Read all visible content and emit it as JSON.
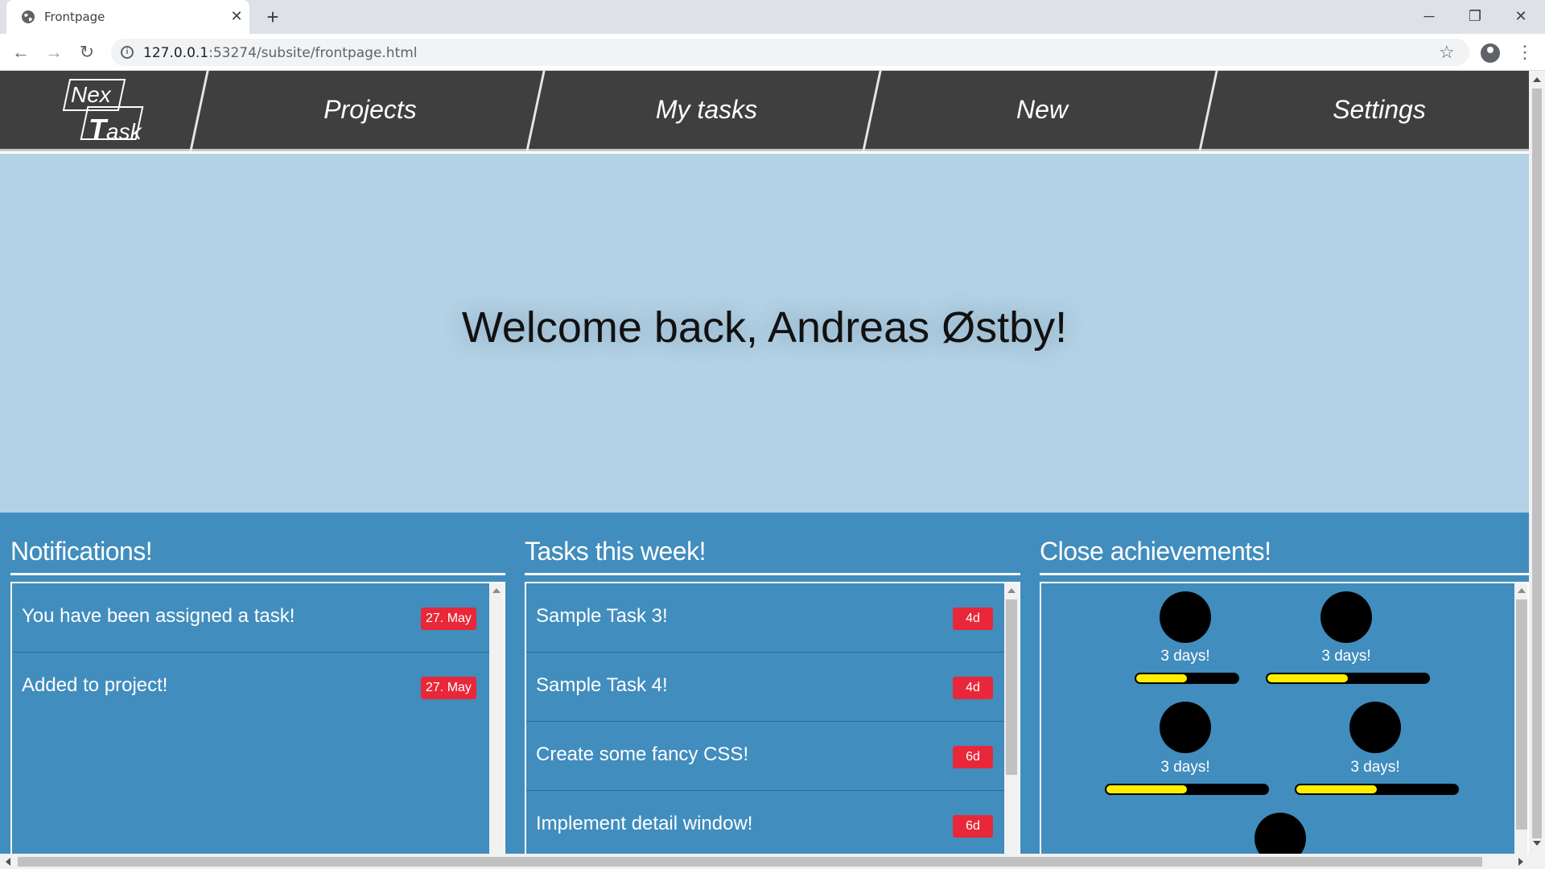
{
  "browser": {
    "tab_title": "Frontpage",
    "tab_close": "✕",
    "new_tab": "+",
    "url_host": "127.0.0.1",
    "url_rest": ":53274/subsite/frontpage.html",
    "minimize": "─",
    "restore": "❐",
    "close": "✕"
  },
  "site_nav": {
    "logo_line1": "Nex",
    "logo_T": "T",
    "logo_line2_rest": "ask",
    "links": [
      "Projects",
      "My tasks",
      "New",
      "Settings"
    ]
  },
  "hero": {
    "title": "Welcome back, Andreas Østby!"
  },
  "notifications": {
    "title": "Notifications!",
    "items": [
      {
        "text": "You have been assigned a task!",
        "date": "27. May"
      },
      {
        "text": "Added to project!",
        "date": "27. May"
      }
    ]
  },
  "tasks": {
    "title": "Tasks this week!",
    "items": [
      {
        "text": "Sample Task 3!",
        "due": "4d"
      },
      {
        "text": "Sample Task 4!",
        "due": "4d"
      },
      {
        "text": "Create some fancy CSS!",
        "due": "6d"
      },
      {
        "text": "Implement detail window!",
        "due": "6d"
      }
    ]
  },
  "achievements": {
    "title": "Close achievements!",
    "items": [
      {
        "label": "3 days!",
        "progress": 0.5
      },
      {
        "label": "3 days!",
        "progress": 0.5
      },
      {
        "label": "3 days!",
        "progress": 0.5
      },
      {
        "label": "3 days!",
        "progress": 0.5
      },
      {
        "label": "",
        "progress": null
      }
    ]
  },
  "colors": {
    "nav_bg": "#3f3f3f",
    "hero_bg": "#b3d2e6",
    "lower_bg": "#418dbe",
    "badge": "#e8283a",
    "progress_fill": "#ffee00"
  }
}
